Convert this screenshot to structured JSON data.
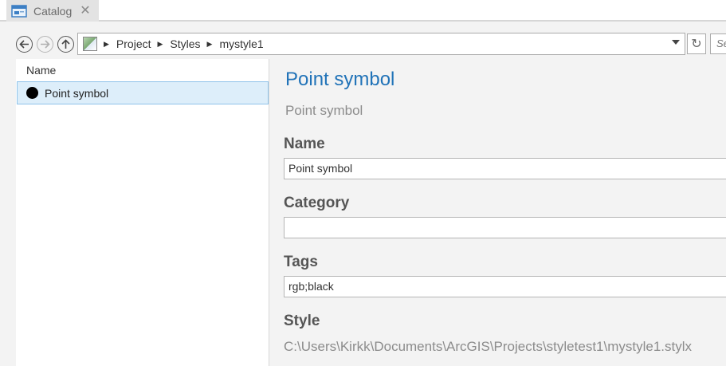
{
  "tab": {
    "title": "Catalog",
    "close_glyph": "✕",
    "icon": "catalog-window-icon"
  },
  "nav": {
    "back_icon": "back-arrow-icon",
    "forward_icon": "forward-arrow-icon",
    "up_icon": "up-arrow-icon",
    "home_icon": "project-icon",
    "breadcrumbs": [
      "Project",
      "Styles",
      "mystyle1"
    ],
    "search_placeholder": "Se",
    "refresh_glyph": "↻"
  },
  "tree": {
    "column_header": "Name",
    "items": [
      {
        "label": "Point symbol",
        "icon": "black-point-symbol-icon",
        "selected": true
      }
    ]
  },
  "details": {
    "title": "Point symbol",
    "subtitle": "Point symbol",
    "name_label": "Name",
    "name_value": "Point symbol",
    "category_label": "Category",
    "category_value": "",
    "tags_label": "Tags",
    "tags_value": "rgb;black",
    "style_label": "Style",
    "style_value": "C:\\Users\\Kirkk\\Documents\\ArcGIS\\Projects\\styletest1\\mystyle1.stylx"
  },
  "colors": {
    "accent": "#2173b8",
    "selection_bg": "#ddeefa",
    "selection_border": "#8fc3ea",
    "panel_bg": "#f3f3f3"
  }
}
